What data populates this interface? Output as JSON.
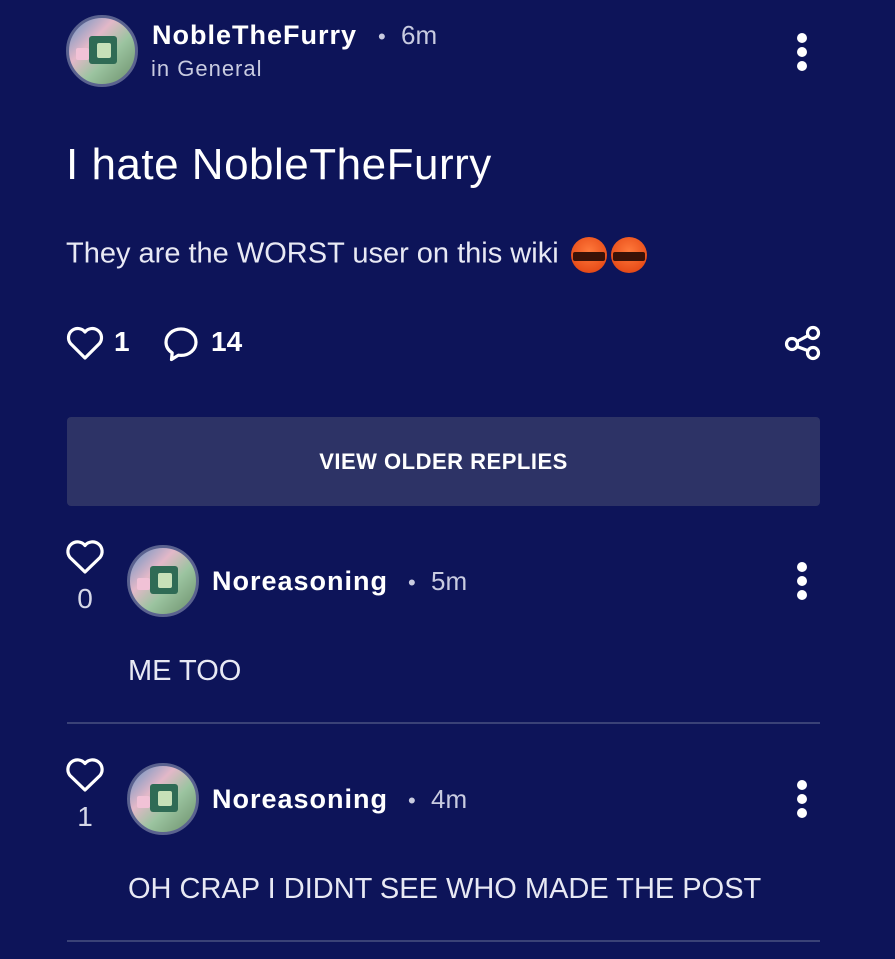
{
  "post": {
    "author": "NobleTheFurry",
    "time": "6m",
    "category": "in General",
    "title": "I hate NobleTheFurry",
    "body": "They are the WORST user on this wiki",
    "emoji": "face-with-symbols-on-mouth",
    "likes": "1",
    "comments": "14"
  },
  "view_older_label": "VIEW OLDER REPLIES",
  "replies": [
    {
      "author": "Noreasoning",
      "time": "5m",
      "votes": "0",
      "text": "ME TOO"
    },
    {
      "author": "Noreasoning",
      "time": "4m",
      "votes": "1",
      "text": "OH CRAP I DIDNT SEE WHO MADE THE POST"
    }
  ],
  "colors": {
    "background": "#0d1459",
    "button": "#2d3366",
    "divider": "#3a4277",
    "muted_text": "#c8cbe0"
  },
  "meta_separator": "•"
}
